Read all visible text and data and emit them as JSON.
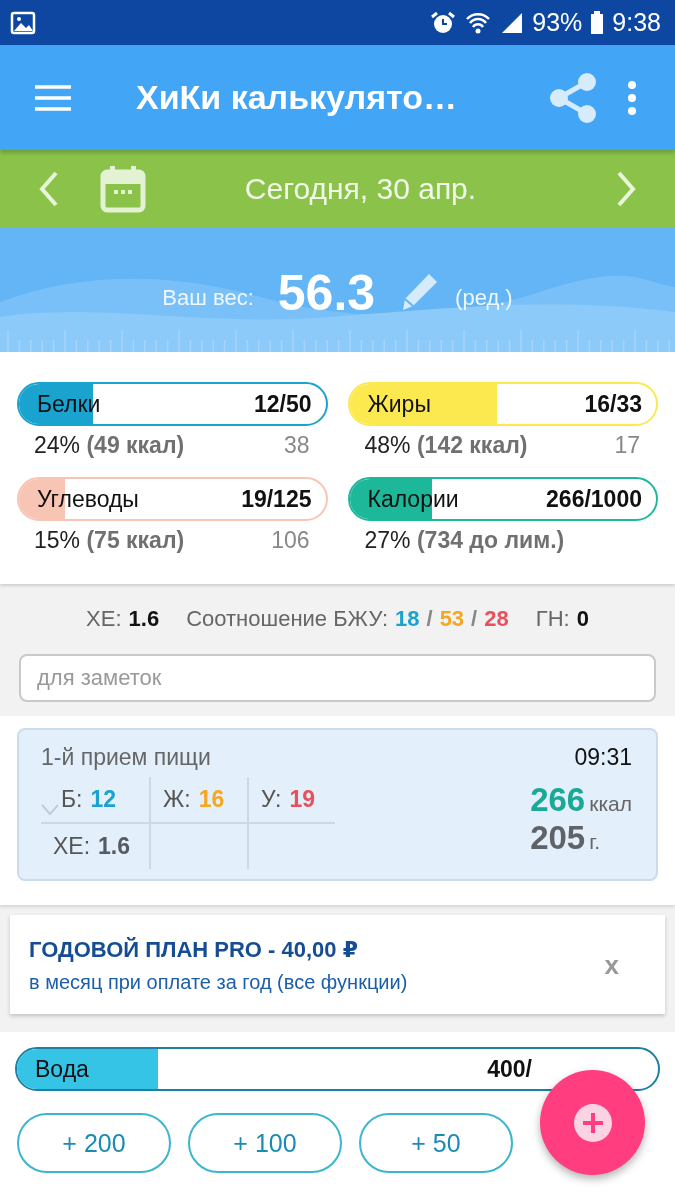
{
  "status_bar": {
    "battery": "93%",
    "time": "9:38"
  },
  "app_bar": {
    "title": "ХиКи калькулято…"
  },
  "date_bar": {
    "date": "Сегодня, 30 апр."
  },
  "weight": {
    "label": "Ваш вес:",
    "value": "56.3",
    "edit": "(ред.)"
  },
  "macros": [
    {
      "name": "Белки",
      "reading": "12/50",
      "level": 0.24,
      "color": "#1ba3cf",
      "percent": "24%",
      "detail": "(49 ккал)",
      "remaining": "38"
    },
    {
      "name": "Жиры",
      "reading": "16/33",
      "level": 0.48,
      "color": "#fce94f",
      "percent": "48%",
      "detail": "(142 ккал)",
      "remaining": "17"
    },
    {
      "name": "Углеводы",
      "reading": "19/125",
      "level": 0.15,
      "color": "#f8c4b4",
      "percent": "15%",
      "detail": "(75 ккал)",
      "remaining": "106"
    },
    {
      "name": "Калории",
      "reading": "266/1000",
      "level": 0.27,
      "color": "#1db89a",
      "percent": "27%",
      "detail": "(734 до лим.)"
    }
  ],
  "summary": {
    "xe_label": "ХЕ:",
    "xe": "1.6",
    "ratio_label": "Соотношение БЖУ:",
    "ratio": [
      {
        "value": "18",
        "color": "#1ba3cf"
      },
      {
        "value": "53",
        "color": "#f5a623"
      },
      {
        "value": "28",
        "color": "#e8505b"
      }
    ],
    "separators": [
      "/",
      "/"
    ],
    "gn_label": "ГН:",
    "gn": "0"
  },
  "notes": {
    "placeholder": "для заметок"
  },
  "meal": {
    "title": "1-й прием пищи",
    "time": "09:31",
    "cells": [
      {
        "label": "Б:",
        "value": "12",
        "color": "#1ba3cf"
      },
      {
        "label": "Ж:",
        "value": "16",
        "color": "#f5a623"
      },
      {
        "label": "У:",
        "value": "19",
        "color": "#e8505b"
      },
      {
        "label": "ХЕ:",
        "value": "1.6",
        "color": "#555a60"
      }
    ],
    "kcal": "266",
    "kcal_unit": "ккал",
    "weight": "205",
    "weight_unit": "г."
  },
  "promo": {
    "title": "ГОДОВОЙ ПЛАН PRO - 40,00 ₽",
    "subtitle": "в месяц при оплате за год (все функции)",
    "close": "x"
  },
  "water": {
    "name": "Вода",
    "reading": "400/",
    "level": 0.22,
    "buttons": [
      "+ 200",
      "+ 100",
      "+ 50"
    ]
  }
}
